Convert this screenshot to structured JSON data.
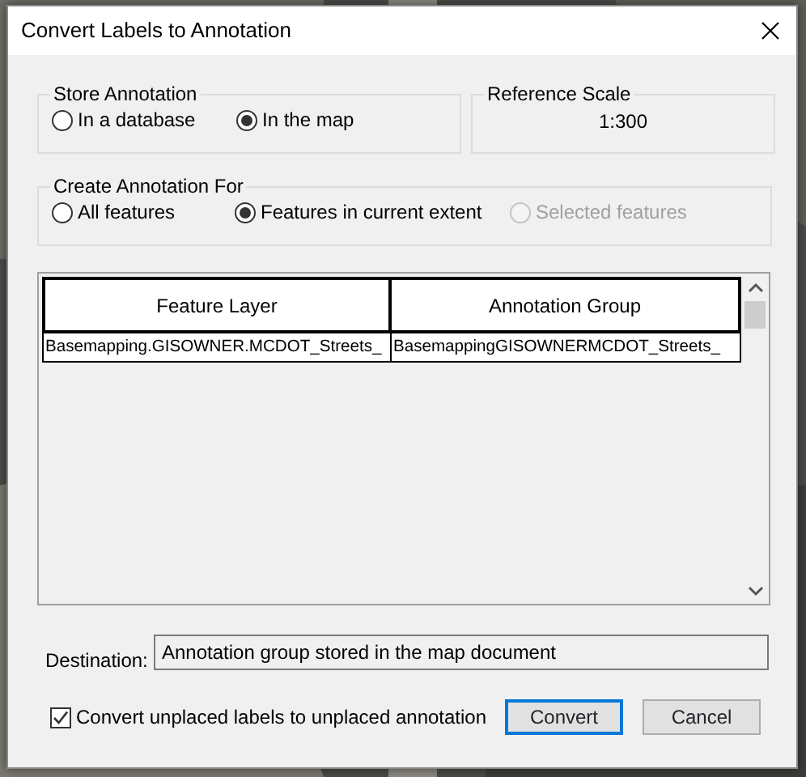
{
  "window": {
    "title": "Convert Labels to Annotation"
  },
  "store_annotation": {
    "label": "Store Annotation",
    "options": [
      {
        "label": "In a database",
        "selected": false,
        "disabled": false
      },
      {
        "label": "In the map",
        "selected": true,
        "disabled": false
      }
    ]
  },
  "reference_scale": {
    "label": "Reference Scale",
    "value": "1:300"
  },
  "create_annotation_for": {
    "label": "Create Annotation For",
    "options": [
      {
        "label": "All features",
        "selected": false,
        "disabled": false
      },
      {
        "label": "Features in current extent",
        "selected": true,
        "disabled": false
      },
      {
        "label": "Selected features",
        "selected": false,
        "disabled": true
      }
    ]
  },
  "table": {
    "columns": [
      "Feature Layer",
      "Annotation Group"
    ],
    "rows": [
      [
        "Basemapping.GISOWNER.MCDOT_Streets_",
        "BasemappingGISOWNERMCDOT_Streets_"
      ]
    ]
  },
  "destination": {
    "label": "Destination:",
    "value": "Annotation group stored in the map document"
  },
  "convert_unplaced": {
    "label": "Convert unplaced labels to unplaced annotation",
    "checked": true
  },
  "buttons": [
    {
      "label": "Convert",
      "default": true
    },
    {
      "label": "Cancel",
      "default": false
    }
  ]
}
